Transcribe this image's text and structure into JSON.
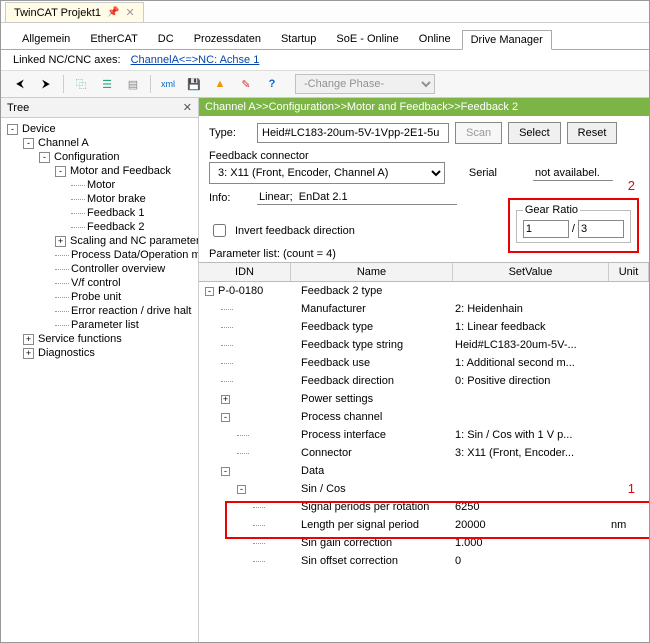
{
  "file_tab": {
    "title": "TwinCAT Projekt1"
  },
  "main_tabs": [
    "Allgemein",
    "EtherCAT",
    "DC",
    "Prozessdaten",
    "Startup",
    "SoE - Online",
    "Online",
    "Drive Manager"
  ],
  "active_tab": 7,
  "linked": {
    "label": "Linked NC/CNC axes:",
    "link": "ChannelA<=>NC: Achse 1"
  },
  "phase_select": "-Change Phase-",
  "tree": {
    "header": "Tree",
    "nodes": [
      {
        "lvl": 1,
        "toggle": "-",
        "label": "Device"
      },
      {
        "lvl": 2,
        "toggle": "-",
        "label": "Channel A"
      },
      {
        "lvl": 3,
        "toggle": "-",
        "label": "Configuration"
      },
      {
        "lvl": 4,
        "toggle": "-",
        "label": "Motor and Feedback"
      },
      {
        "lvl": 5,
        "label": "Motor"
      },
      {
        "lvl": 5,
        "label": "Motor brake"
      },
      {
        "lvl": 5,
        "label": "Feedback 1"
      },
      {
        "lvl": 5,
        "label": "Feedback 2"
      },
      {
        "lvl": 4,
        "toggle": "+",
        "label": "Scaling and NC parameters"
      },
      {
        "lvl": 4,
        "label": "Process Data/Operation mode"
      },
      {
        "lvl": 4,
        "label": "Controller overview"
      },
      {
        "lvl": 4,
        "label": "V/f control"
      },
      {
        "lvl": 4,
        "label": "Probe unit"
      },
      {
        "lvl": 4,
        "label": "Error reaction / drive halt"
      },
      {
        "lvl": 4,
        "label": "Parameter list"
      },
      {
        "lvl": 2,
        "toggle": "+",
        "label": "Service functions"
      },
      {
        "lvl": 2,
        "toggle": "+",
        "label": "Diagnostics"
      }
    ]
  },
  "breadcrumb": "Channel A>>Configuration>>Motor and Feedback>>Feedback 2",
  "form": {
    "type_label": "Type:",
    "type_value": "Heid#LC183-20um-5V-1Vpp-2E1-5u",
    "scan": "Scan",
    "select": "Select",
    "reset": "Reset",
    "fbconn_label": "Feedback connector",
    "fbconn_value": "3: X11 (Front, Encoder, Channel A)",
    "serial_label": "Serial",
    "serial_value": "not availabel.",
    "info_label": "Info:",
    "info_value": "Linear;  EnDat 2.1",
    "gear_label": "Gear Ratio",
    "gear_num": "1",
    "gear_den": "3",
    "annot2": "2",
    "invert_label": "Invert feedback direction"
  },
  "param_list_label": "Parameter list: (count = 4)",
  "param_header": {
    "idn": "IDN",
    "name": "Name",
    "val": "SetValue",
    "unit": "Unit"
  },
  "param_rows": [
    {
      "lvl": 0,
      "toggle": "-",
      "idn": "P-0-0180",
      "name": "Feedback 2 type",
      "val": "",
      "unit": ""
    },
    {
      "lvl": 1,
      "name": "Manufacturer",
      "val": "2: Heidenhain",
      "unit": ""
    },
    {
      "lvl": 1,
      "name": "Feedback type",
      "val": "1: Linear feedback",
      "unit": ""
    },
    {
      "lvl": 1,
      "name": "Feedback type string",
      "val": "Heid#LC183-20um-5V-...",
      "unit": ""
    },
    {
      "lvl": 1,
      "name": "Feedback use",
      "val": "1: Additional second m...",
      "unit": ""
    },
    {
      "lvl": 1,
      "name": "Feedback direction",
      "val": "0: Positive direction",
      "unit": ""
    },
    {
      "lvl": 1,
      "toggle": "+",
      "name": "Power settings",
      "val": "",
      "unit": ""
    },
    {
      "lvl": 1,
      "toggle": "-",
      "name": "Process channel",
      "val": "",
      "unit": ""
    },
    {
      "lvl": 2,
      "name": "Process interface",
      "val": "1: Sin / Cos with 1 V p...",
      "unit": ""
    },
    {
      "lvl": 2,
      "name": "Connector",
      "val": "3: X11 (Front, Encoder...",
      "unit": ""
    },
    {
      "lvl": 1,
      "toggle": "-",
      "name": "Data",
      "val": "",
      "unit": ""
    },
    {
      "lvl": 2,
      "toggle": "-",
      "name": "Sin / Cos",
      "val": "",
      "unit": ""
    },
    {
      "lvl": 3,
      "name": "Signal periods per rotation",
      "val": "6250",
      "unit": ""
    },
    {
      "lvl": 3,
      "name": "Length per signal period",
      "val": "20000",
      "unit": "nm"
    },
    {
      "lvl": 3,
      "name": "Sin gain correction",
      "val": "1.000",
      "unit": ""
    },
    {
      "lvl": 3,
      "name": "Sin offset correction",
      "val": "0",
      "unit": ""
    }
  ],
  "annot1": "1"
}
